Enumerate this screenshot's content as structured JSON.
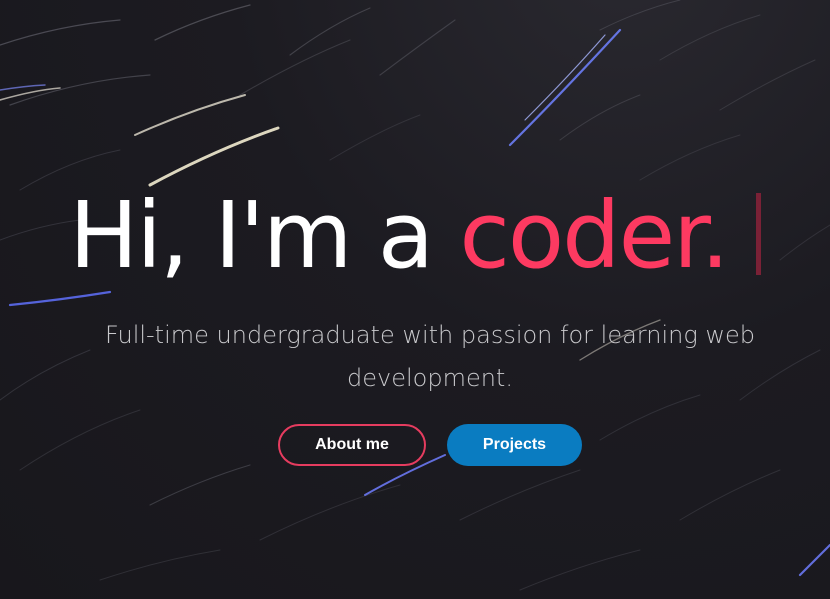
{
  "hero": {
    "headline_prefix": "Hi, I'm a ",
    "headline_accent": "coder.",
    "subtitle": "Full-time undergraduate with passion for learning web development.",
    "colors": {
      "accent": "#fd3a61",
      "primary_button": "#0a7cc1",
      "background": "#1b1a1f"
    }
  },
  "buttons": {
    "about_label": "About me",
    "projects_label": "Projects"
  }
}
